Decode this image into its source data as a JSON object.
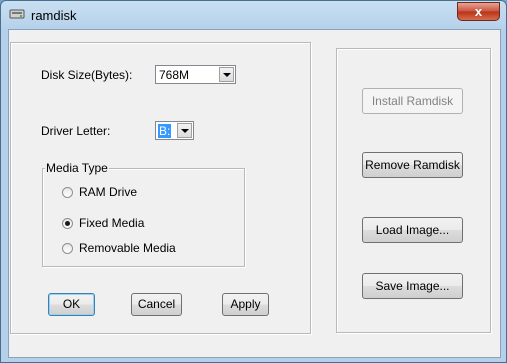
{
  "window": {
    "title": "ramdisk",
    "close_symbol": "x"
  },
  "icons": {
    "app": "disk-icon",
    "close": "close-icon",
    "dropdown": "chevron-down-icon"
  },
  "settings": {
    "disk_size_label": "Disk Size(Bytes):",
    "disk_size_value": "768M",
    "driver_letter_label": "Driver Letter:",
    "driver_letter_value": "B:"
  },
  "media_type": {
    "title": "Media Type",
    "options": [
      {
        "label": "RAM Drive",
        "selected": false
      },
      {
        "label": "Fixed Media",
        "selected": true
      },
      {
        "label": "Removable Media",
        "selected": false
      }
    ]
  },
  "buttons": {
    "ok": "OK",
    "cancel": "Cancel",
    "apply": "Apply"
  },
  "actions": {
    "install": "Install Ramdisk",
    "remove": "Remove Ramdisk",
    "load": "Load Image...",
    "save": "Save Image..."
  },
  "colors": {
    "accent": "#3399ff",
    "close_button": "#c9523c",
    "titlebar": "#b4d0ea"
  }
}
